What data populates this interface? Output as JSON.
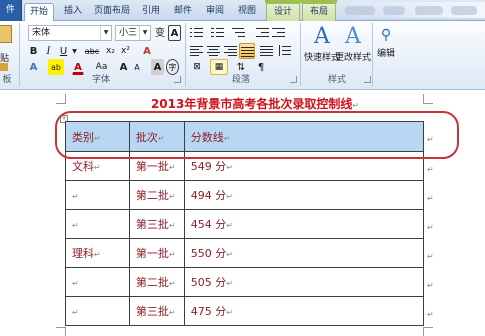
{
  "tabs": [
    {
      "label": "件",
      "kind": "file"
    },
    {
      "label": "开始",
      "kind": "active"
    },
    {
      "label": "插入",
      "kind": "normal"
    },
    {
      "label": "页面布局",
      "kind": "normal"
    },
    {
      "label": "引用",
      "kind": "normal"
    },
    {
      "label": "邮件",
      "kind": "normal"
    },
    {
      "label": "审阅",
      "kind": "normal"
    },
    {
      "label": "视图",
      "kind": "normal"
    },
    {
      "label": "设计",
      "kind": "context"
    },
    {
      "label": "布局",
      "kind": "context"
    }
  ],
  "ribbon": {
    "font_name": "宋体",
    "font_size": "小三",
    "clipboard_partial_label": "贴",
    "clipboard_group_partial": "板",
    "group_font": "字体",
    "group_paragraph": "段落",
    "group_styles": "样式",
    "quick_styles_label": "快速样式",
    "change_styles_label": "更改样式",
    "edit_label": "编辑",
    "bold": "B",
    "italic": "I",
    "underline": "U",
    "strikethrough": "abc",
    "subscript": "x₂",
    "superscript": "x²",
    "grow_font": "A",
    "shrink_font": "A",
    "clear_format": "A",
    "font_color": "A",
    "highlight": "ab",
    "char_shading": "A",
    "change_case": "Aa",
    "char_border": "A",
    "phonetic": "变",
    "enclose": "字"
  },
  "document": {
    "title": "2013年背景市高考各批次录取控制线",
    "paragraph_mark": "↵",
    "table": {
      "header": [
        "类别",
        "批次",
        "分数线"
      ],
      "rows": [
        [
          "文科",
          "第一批",
          "549 分"
        ],
        [
          "",
          "第二批",
          "494 分"
        ],
        [
          "",
          "第三批",
          "454 分"
        ],
        [
          "理科",
          "第一批",
          "550 分"
        ],
        [
          "",
          "第二批",
          "505 分"
        ],
        [
          "",
          "第三批",
          "475 分"
        ]
      ]
    }
  },
  "colors": {
    "title_red": "#d0111b",
    "header_fill": "#b7d7f2",
    "annotation_ring": "#c73339",
    "cell_text": "#8b1f28"
  }
}
